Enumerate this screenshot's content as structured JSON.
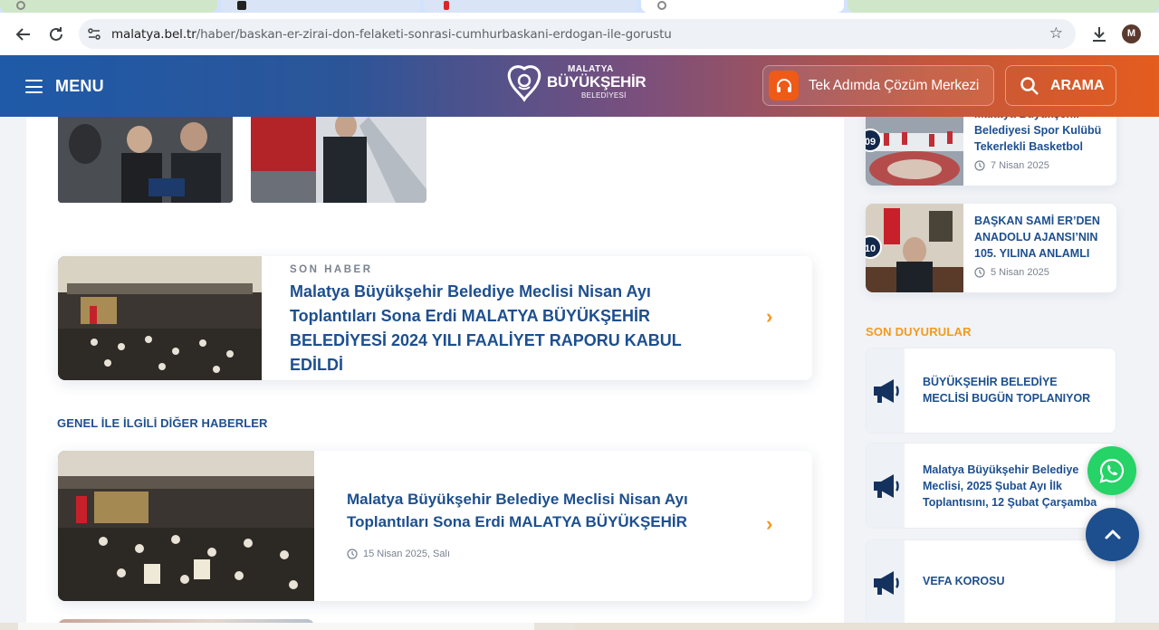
{
  "browser": {
    "url_host": "malatya.bel.tr",
    "url_path": "/haber/baskan-er-zirai-don-felaketi-sonrasi-cumhurbaskani-erdogan-ile-gorustu",
    "profile_initial": "M",
    "icons": [
      "back-arrow-icon",
      "reload-icon",
      "site-info-icon",
      "star-icon",
      "download-icon"
    ]
  },
  "header": {
    "menu_label": "MENU",
    "logo_line1": "MALATYA",
    "logo_line2": "BÜYÜKŞEHİR",
    "logo_line3": "BELEDİYESİ",
    "solution_label": "Tek Adımda Çözüm Merkezi",
    "search_label": "ARAMA",
    "colors": {
      "gradient_start": "#1e5aa8",
      "gradient_end": "#e45c1e",
      "accent_orange": "#ef5a17"
    }
  },
  "main": {
    "latest": {
      "kicker": "SON HABER",
      "title": "Malatya Büyükşehir Belediye Meclisi Nisan Ayı Toplantıları Sona Erdi MALATYA BÜYÜKŞEHİR BELEDİYESİ 2024 YILI FAALİYET RAPORU KABUL EDİLDİ"
    },
    "related_heading": "GENEL İLE İLGİLİ DİĞER HABERLER",
    "related": [
      {
        "title": "Malatya Büyükşehir Belediye Meclisi Nisan Ayı Toplantıları Sona Erdi MALATYA BÜYÜKŞEHİR",
        "date": "15 Nisan 2025, Salı"
      }
    ]
  },
  "sidebar": {
    "popular": [
      {
        "rank": "09",
        "title": "Malatya Büyükşehir Belediyesi Spor Kulübü Tekerlekli Basketbol",
        "date": "7 Nisan 2025"
      },
      {
        "rank": "10",
        "title": "BAŞKAN SAMİ ER’DEN ANADOLU AJANSI’NIN 105. YILINA ANLAMLI",
        "date": "5 Nisan 2025"
      }
    ],
    "announcements_heading": "SON DUYURULAR",
    "announcements": [
      {
        "title": "BÜYÜKŞEHİR BELEDİYE MECLİSİ BUGÜN TOPLANIYOR"
      },
      {
        "title": "Malatya Büyükşehir Belediye Meclisi, 2025 Şubat Ayı İlk Toplantısını, 12 Şubat Çarşamba"
      },
      {
        "title": "VEFA KOROSU"
      }
    ]
  },
  "floating": {
    "whatsapp_color": "#25d366",
    "scroll_top_color": "#1d4f8f"
  }
}
